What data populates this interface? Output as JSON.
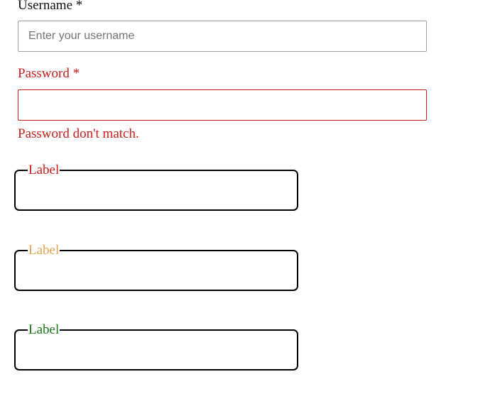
{
  "username": {
    "label": "Username *",
    "placeholder": "Enter your username",
    "value": ""
  },
  "password": {
    "label": "Password *",
    "value": "",
    "error": "Password don't match."
  },
  "outlined_fields": [
    {
      "label": "Label",
      "state": "error",
      "color": "#cc1f1a"
    },
    {
      "label": "Label",
      "state": "warning",
      "color": "#e5a552"
    },
    {
      "label": "Label",
      "state": "success",
      "color": "#1a7a1a"
    }
  ]
}
